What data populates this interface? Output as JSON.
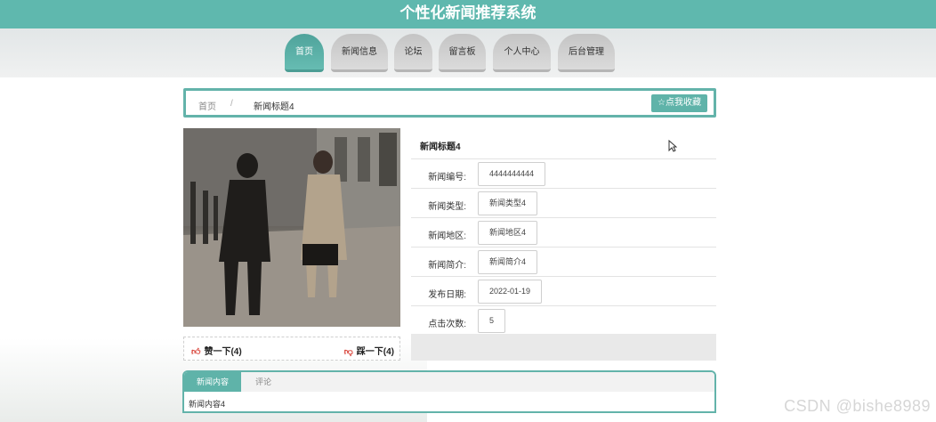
{
  "header": {
    "title": "个性化新闻推荐系统"
  },
  "nav": {
    "items": [
      {
        "label": "首页",
        "active": true
      },
      {
        "label": "新闻信息",
        "active": false
      },
      {
        "label": "论坛",
        "active": false
      },
      {
        "label": "留言板",
        "active": false
      },
      {
        "label": "个人中心",
        "active": false
      },
      {
        "label": "后台管理",
        "active": false
      }
    ]
  },
  "breadcrumb": {
    "home": "首页",
    "separator": "/",
    "current": "新闻标题4",
    "favorite_label": "☆点我收藏"
  },
  "vote": {
    "like_label": "赞一下(4)",
    "dislike_label": "踩一下(4)"
  },
  "detail": {
    "title": "新闻标题4",
    "fields": [
      {
        "label": "新闻编号:",
        "value": "4444444444"
      },
      {
        "label": "新闻类型:",
        "value": "新闻类型4"
      },
      {
        "label": "新闻地区:",
        "value": "新闻地区4"
      },
      {
        "label": "新闻简介:",
        "value": "新闻简介4"
      },
      {
        "label": "发布日期:",
        "value": "2022-01-19"
      },
      {
        "label": "点击次数:",
        "value": "5"
      }
    ]
  },
  "content_tabs": {
    "tabs": [
      {
        "label": "新闻内容",
        "active": true
      },
      {
        "label": "评论",
        "active": false
      }
    ],
    "body": "新闻内容4"
  },
  "watermark": "CSDN @bishe8989",
  "colors": {
    "brand": "#5fb8ae",
    "like": "#d9443a"
  }
}
